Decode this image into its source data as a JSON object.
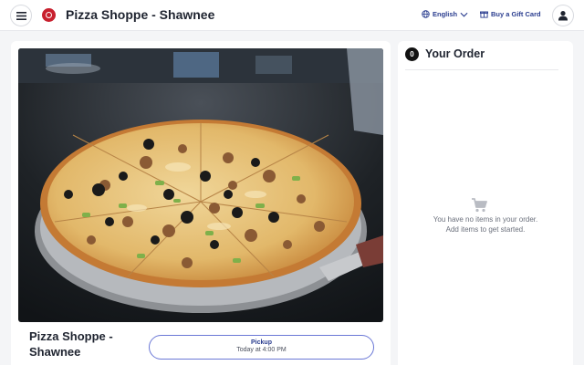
{
  "header": {
    "title": "Pizza Shoppe - Shawnee",
    "language": "English",
    "gift_card": "Buy a Gift Card"
  },
  "icons": {
    "menu": "hamburger-menu-icon",
    "logo": "restaurant-logo",
    "language": "globe-icon",
    "chevron": "chevron-down-icon",
    "gift": "gift-icon",
    "account": "user-icon",
    "cart": "shopping-cart-icon"
  },
  "colors": {
    "accent": "#2a3d8f",
    "brand": "#c8202e",
    "pickup_border": "#6b78d6"
  },
  "main": {
    "store_name": "Pizza Shoppe - Shawnee",
    "pickup": {
      "label": "Pickup",
      "time": "Today at 4:00 PM"
    }
  },
  "order": {
    "count": "0",
    "title": "Your Order",
    "empty_line1": "You have no items in your order.",
    "empty_line2": "Add items to get started."
  }
}
